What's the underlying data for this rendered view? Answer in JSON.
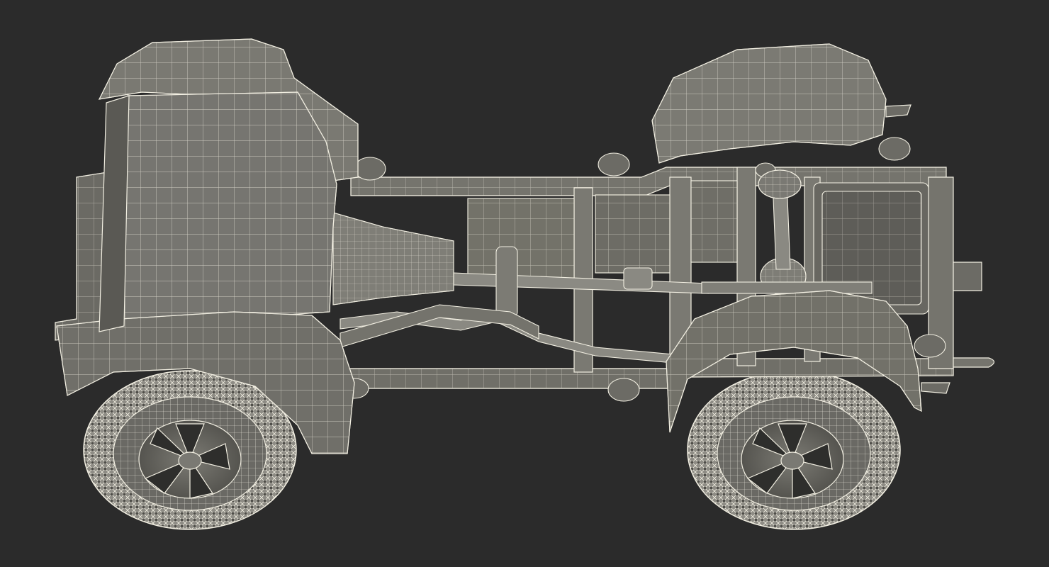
{
  "scene": {
    "subject": "vehicle-chassis-wireframe-render",
    "colors": {
      "background": "#2b2b2b",
      "body": "#6f6e68",
      "body_light": "#86857e",
      "body_dark": "#4d4c47",
      "wire": "#f2efe2",
      "tire": "#8e8c85",
      "tire_dark": "#5a5954",
      "rim": "#6a6964"
    }
  }
}
